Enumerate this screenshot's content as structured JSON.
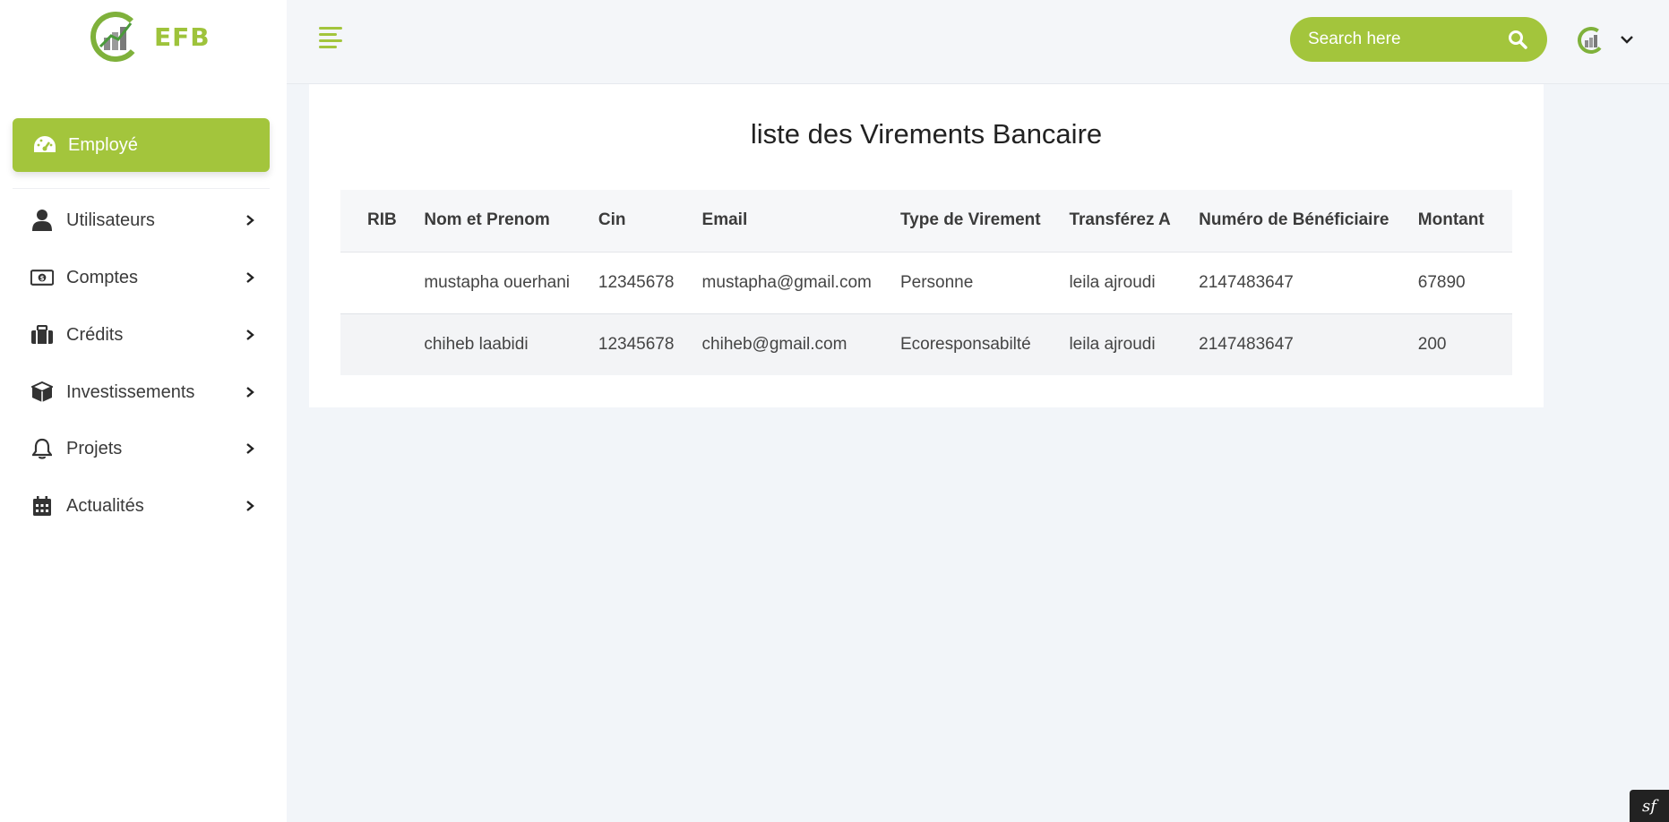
{
  "brand": {
    "name": "EFB",
    "accent": "#a3c53c"
  },
  "sidebar": {
    "active": {
      "label": "Employé",
      "icon": "dashboard-gauge-icon"
    },
    "items": [
      {
        "label": "Utilisateurs",
        "icon": "user-icon"
      },
      {
        "label": "Comptes",
        "icon": "money-bill-icon"
      },
      {
        "label": "Crédits",
        "icon": "briefcase-icon"
      },
      {
        "label": "Investissements",
        "icon": "cube-icon"
      },
      {
        "label": "Projets",
        "icon": "bell-icon"
      },
      {
        "label": "Actualités",
        "icon": "calendar-icon"
      }
    ]
  },
  "header": {
    "search_placeholder": "Search here"
  },
  "main": {
    "title": "liste des Virements Bancaire",
    "table": {
      "columns": [
        "RIB",
        "Nom et Prenom",
        "Cin",
        "Email",
        "Type de Virement",
        "Transférez A",
        "Numéro de Bénéficiaire",
        "Montant"
      ],
      "rows": [
        [
          "",
          "mustapha ouerhani",
          "12345678",
          "mustapha@gmail.com",
          "Personne",
          "leila ajroudi",
          "2147483647",
          "67890"
        ],
        [
          "",
          "chiheb laabidi",
          "12345678",
          "chiheb@gmail.com",
          "Ecoresponsabilté",
          "leila ajroudi",
          "2147483647",
          "200"
        ]
      ]
    }
  },
  "debug_badge": {
    "label": "sf"
  }
}
